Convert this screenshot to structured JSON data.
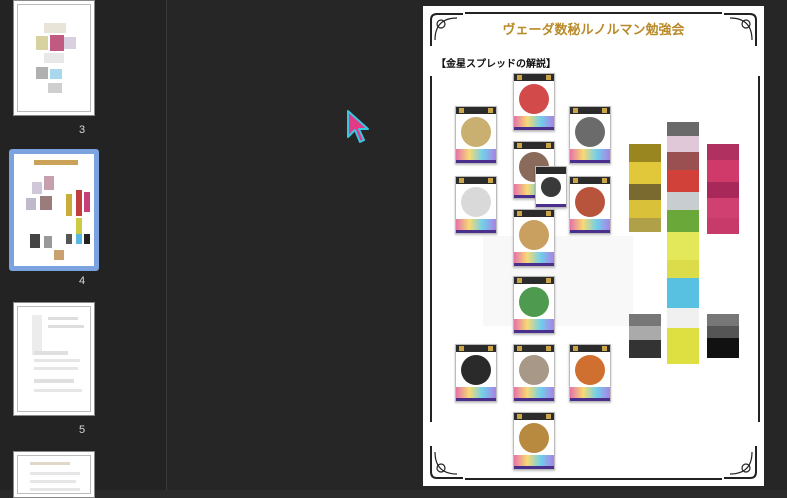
{
  "sidebar": {
    "thumbnails": [
      {
        "number": "3",
        "selected": false
      },
      {
        "number": "4",
        "selected": true
      },
      {
        "number": "5",
        "selected": false
      },
      {
        "number": "",
        "selected": false
      }
    ]
  },
  "document": {
    "title": "ヴェーダ数秘ルノルマン勉強会",
    "section_heading": "【金星スプレッドの解説】"
  },
  "icons": {
    "cursor": "arrow-cursor-icon"
  },
  "colors": {
    "title_gold": "#b98a2a",
    "cursor_pink": "#e23a86",
    "cursor_cyan": "#38c6e0",
    "selection_blue": "#7aa3e0"
  }
}
